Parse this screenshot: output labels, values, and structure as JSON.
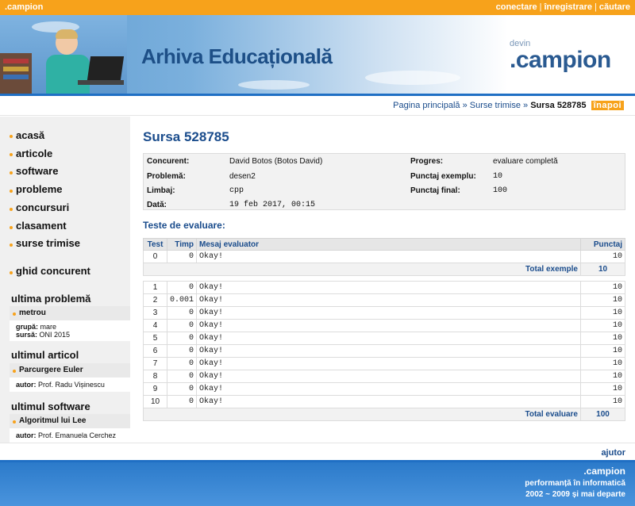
{
  "topbar": {
    "brand": ".campion",
    "links": [
      "conectare",
      "înregistrare",
      "căutare"
    ]
  },
  "header": {
    "title": "Arhiva Educațională",
    "logo_small": "devin",
    "logo_name": ".campion"
  },
  "breadcrumb": {
    "items": [
      "Pagina principală",
      "Surse trimise"
    ],
    "separator": "»",
    "current": "Sursa 528785",
    "back_label": "înapoi"
  },
  "sidebar": {
    "nav": [
      "acasă",
      "articole",
      "software",
      "probleme",
      "concursuri",
      "clasament",
      "surse trimise"
    ],
    "guide": "ghid concurent",
    "last_problem": {
      "heading": "ultima problemă",
      "name": "metrou",
      "group_label": "grupă:",
      "group": "mare",
      "source_label": "sursă:",
      "source": "ONI 2015"
    },
    "last_article": {
      "heading": "ultimul articol",
      "name": "Parcurgere Euler",
      "author_label": "autor:",
      "author": "Prof. Radu Vișinescu"
    },
    "last_software": {
      "heading": "ultimul software",
      "name": "Algoritmul lui Lee",
      "author_label": "autor:",
      "author": "Prof. Emanuela Cerchez"
    }
  },
  "main": {
    "title": "Sursa 528785",
    "info": {
      "concurent_label": "Concurent:",
      "concurent": "David Botos (Botos David)",
      "problema_label": "Problemă:",
      "problema": "desen2",
      "limbaj_label": "Limbaj:",
      "limbaj": "cpp",
      "data_label": "Dată:",
      "data": "19 feb 2017, 00:15",
      "progres_label": "Progres:",
      "progres": "evaluare completă",
      "exemplu_label": "Punctaj exemplu:",
      "exemplu": "10",
      "final_label": "Punctaj final:",
      "final": "100"
    },
    "tests_heading": "Teste de evaluare:",
    "table": {
      "headers": [
        "Test",
        "Timp",
        "Mesaj evaluator",
        "Punctaj"
      ],
      "example_rows": [
        {
          "test": "0",
          "time": "0",
          "msg": "Okay!",
          "score": "10"
        }
      ],
      "example_total_label": "Total exemple",
      "example_total": "10",
      "rows": [
        {
          "test": "1",
          "time": "0",
          "msg": "Okay!",
          "score": "10"
        },
        {
          "test": "2",
          "time": "0.001",
          "msg": "Okay!",
          "score": "10"
        },
        {
          "test": "3",
          "time": "0",
          "msg": "Okay!",
          "score": "10"
        },
        {
          "test": "4",
          "time": "0",
          "msg": "Okay!",
          "score": "10"
        },
        {
          "test": "5",
          "time": "0",
          "msg": "Okay!",
          "score": "10"
        },
        {
          "test": "6",
          "time": "0",
          "msg": "Okay!",
          "score": "10"
        },
        {
          "test": "7",
          "time": "0",
          "msg": "Okay!",
          "score": "10"
        },
        {
          "test": "8",
          "time": "0",
          "msg": "Okay!",
          "score": "10"
        },
        {
          "test": "9",
          "time": "0",
          "msg": "Okay!",
          "score": "10"
        },
        {
          "test": "10",
          "time": "0",
          "msg": "Okay!",
          "score": "10"
        }
      ],
      "total_label": "Total evaluare",
      "total": "100"
    }
  },
  "footer": {
    "help": "ajutor",
    "brand": ".campion",
    "tagline": "performanță în informatică",
    "years": "2002 ~ 2009 și mai departe"
  },
  "colors": {
    "accent": "#f7a21b",
    "link": "#1a4c8c",
    "header_blue": "#1f6fc4"
  }
}
